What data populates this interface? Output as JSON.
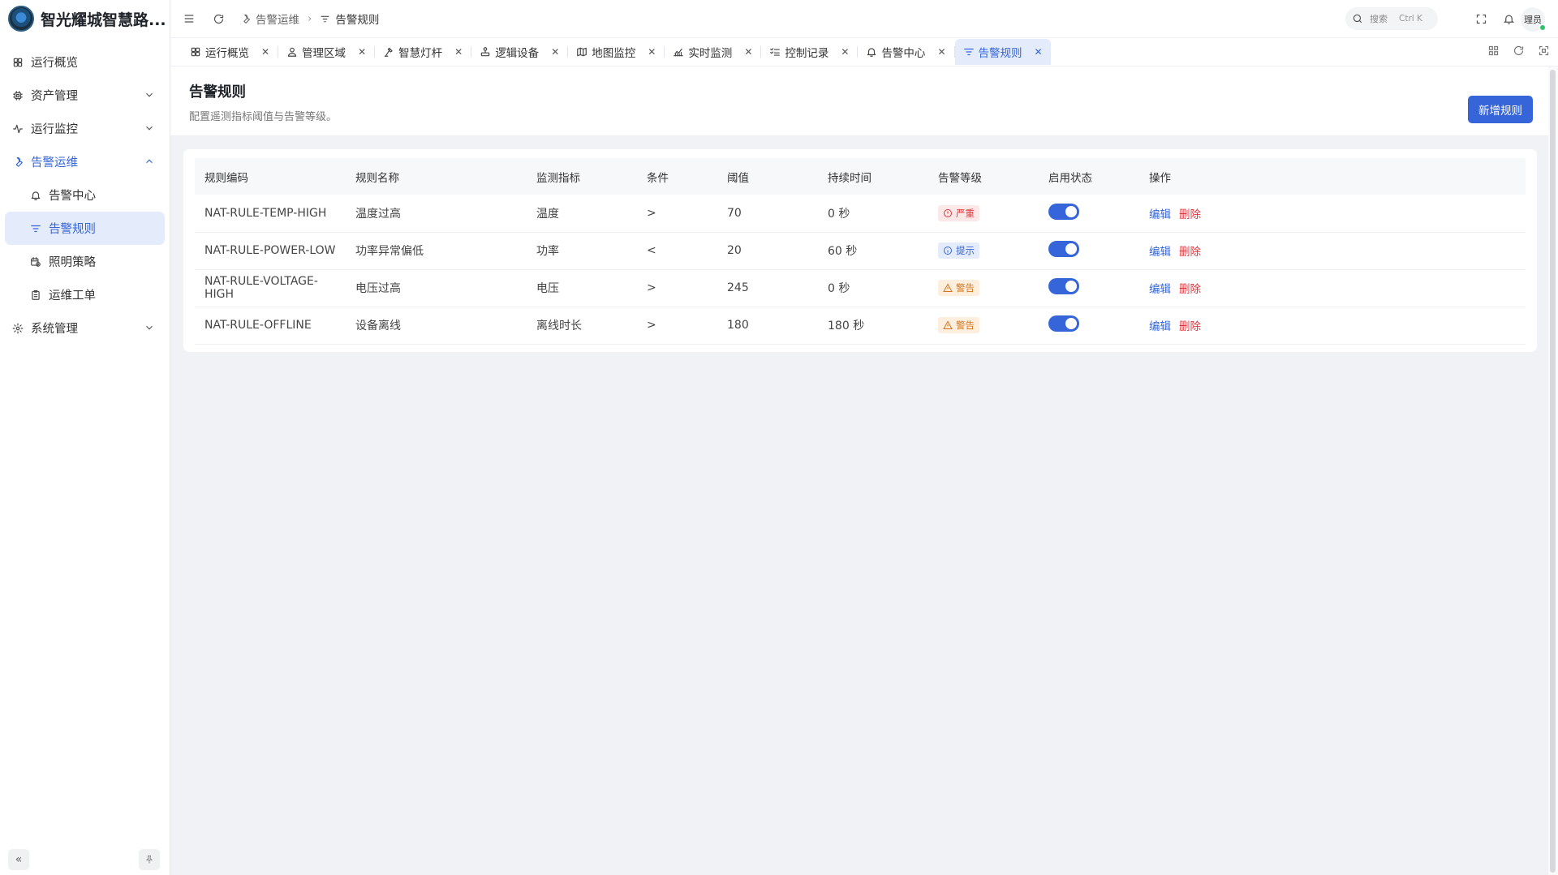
{
  "app": {
    "title": "智光耀城智慧路..."
  },
  "sidebar": {
    "items": [
      {
        "label": "运行概览",
        "icon": "dashboard-icon",
        "level": 0
      },
      {
        "label": "资产管理",
        "icon": "chip-icon",
        "level": 0,
        "expandable": true,
        "expanded": false
      },
      {
        "label": "运行监控",
        "icon": "activity-icon",
        "level": 0,
        "expandable": true,
        "expanded": false
      },
      {
        "label": "告警运维",
        "icon": "wrench-icon",
        "level": 0,
        "expandable": true,
        "expanded": true
      },
      {
        "label": "告警中心",
        "icon": "bell-icon",
        "level": 1
      },
      {
        "label": "告警规则",
        "icon": "filter-icon",
        "level": 1,
        "active": true
      },
      {
        "label": "照明策略",
        "icon": "calendar-clock-icon",
        "level": 1
      },
      {
        "label": "运维工单",
        "icon": "clipboard-icon",
        "level": 1
      },
      {
        "label": "系统管理",
        "icon": "gear-icon",
        "level": 0,
        "expandable": true,
        "expanded": false
      }
    ]
  },
  "header": {
    "breadcrumb": [
      "告警运维",
      "告警规则"
    ],
    "search": {
      "placeholder": "搜索",
      "shortcut": "Ctrl K"
    },
    "user": "理员"
  },
  "tabs": [
    {
      "label": "运行概览",
      "icon": "dashboard-icon"
    },
    {
      "label": "管理区域",
      "icon": "map-pin-icon"
    },
    {
      "label": "智慧灯杆",
      "icon": "lamp-icon"
    },
    {
      "label": "逻辑设备",
      "icon": "network-icon"
    },
    {
      "label": "地图监控",
      "icon": "map-icon"
    },
    {
      "label": "实时监测",
      "icon": "chart-line-icon"
    },
    {
      "label": "控制记录",
      "icon": "list-checks-icon"
    },
    {
      "label": "告警中心",
      "icon": "bell-icon"
    },
    {
      "label": "告警规则",
      "icon": "filter-icon",
      "active": true
    }
  ],
  "page": {
    "title": "告警规则",
    "description": "配置遥测指标阈值与告警等级。",
    "add_button": "新增规则"
  },
  "table": {
    "columns": [
      "规则编码",
      "规则名称",
      "监测指标",
      "条件",
      "阈值",
      "持续时间",
      "告警等级",
      "启用状态",
      "操作"
    ],
    "edit_label": "编辑",
    "delete_label": "删除",
    "rows": [
      {
        "code": "NAT-RULE-TEMP-HIGH",
        "name": "温度过高",
        "metric": "温度",
        "cond": ">",
        "threshold": "70",
        "duration": "0 秒",
        "level": "严重",
        "level_type": "critical",
        "enabled": true
      },
      {
        "code": "NAT-RULE-POWER-LOW",
        "name": "功率异常偏低",
        "metric": "功率",
        "cond": "<",
        "threshold": "20",
        "duration": "60 秒",
        "level": "提示",
        "level_type": "info",
        "enabled": true
      },
      {
        "code": "NAT-RULE-VOLTAGE-HIGH",
        "name": "电压过高",
        "metric": "电压",
        "cond": ">",
        "threshold": "245",
        "duration": "0 秒",
        "level": "警告",
        "level_type": "warning",
        "enabled": true
      },
      {
        "code": "NAT-RULE-OFFLINE",
        "name": "设备离线",
        "metric": "离线时长",
        "cond": ">",
        "threshold": "180",
        "duration": "180 秒",
        "level": "警告",
        "level_type": "warning",
        "enabled": true
      }
    ]
  },
  "colors": {
    "accent": "#3565d8",
    "critical_fg": "#d9363e",
    "critical_bg": "#fde8e8",
    "info_fg": "#3565d8",
    "info_bg": "#e4ebfb",
    "warning_fg": "#d4751c",
    "warning_bg": "#fdeedd"
  }
}
